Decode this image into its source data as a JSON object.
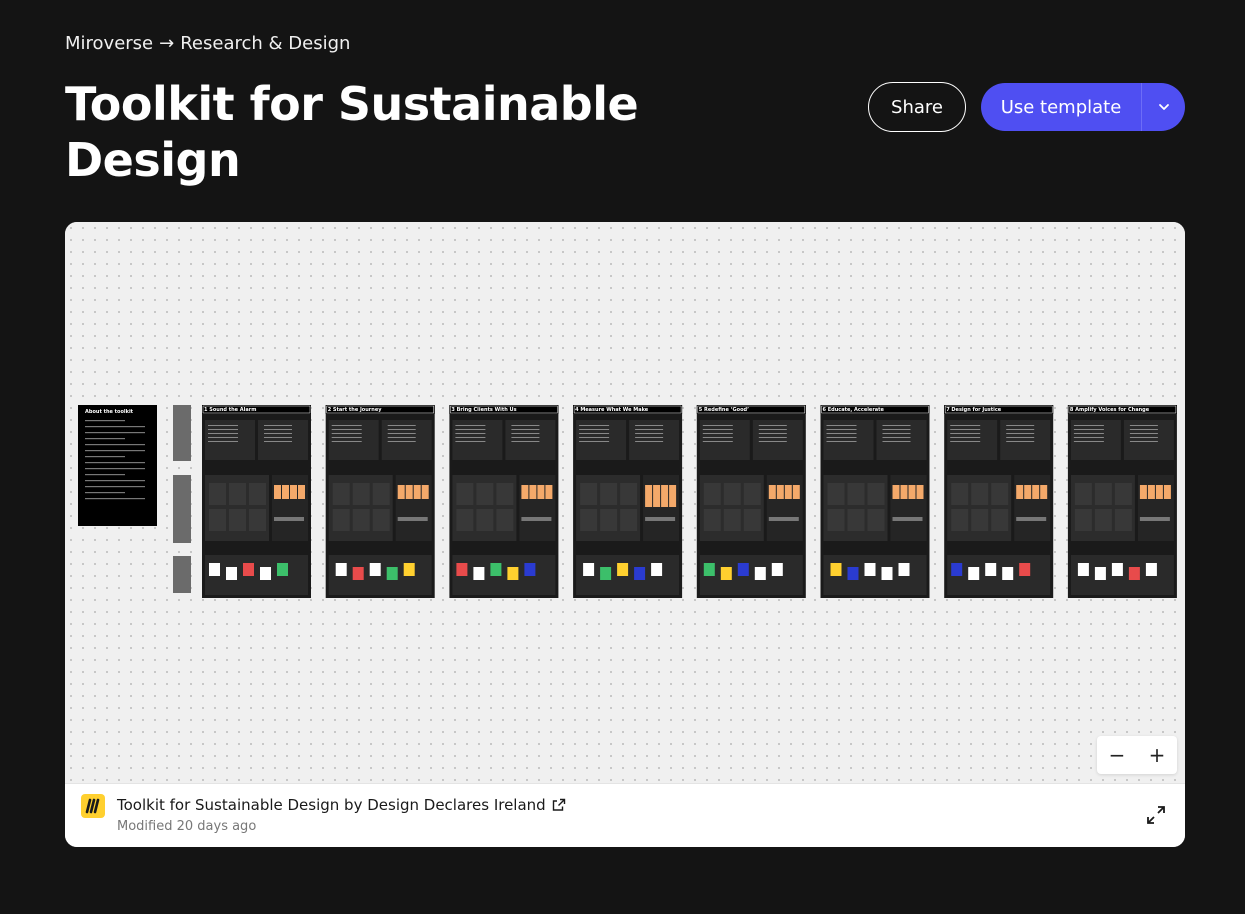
{
  "breadcrumb": {
    "parent": "Miroverse",
    "arrow": "→",
    "current": "Research & Design"
  },
  "page": {
    "title": "Toolkit for Sustainable Design"
  },
  "actions": {
    "share_label": "Share",
    "use_template_label": "Use template"
  },
  "board": {
    "intro_panel": "About the toolkit",
    "frames": [
      {
        "num": "1",
        "title": "Sound the Alarm"
      },
      {
        "num": "2",
        "title": "Start the Journey"
      },
      {
        "num": "3",
        "title": "Bring Clients With Us"
      },
      {
        "num": "4",
        "title": "Measure What We Make"
      },
      {
        "num": "5",
        "title": "Redefine ‘Good’"
      },
      {
        "num": "6",
        "title": "Educate, Accelerate"
      },
      {
        "num": "7",
        "title": "Design for Justice"
      },
      {
        "num": "8",
        "title": "Amplify Voices for Change"
      }
    ],
    "accent_color": "#f4a96a"
  },
  "zoom": {
    "minus": "−",
    "plus": "+"
  },
  "footer": {
    "board_title": "Toolkit for Sustainable Design by Design Declares Ireland",
    "modified": "Modified 20 days ago"
  },
  "colors": {
    "background": "#141414",
    "primary": "#4f4ff2",
    "logo": "#ffd02f"
  },
  "icons": [
    "chevron-down-icon",
    "external-link-icon",
    "expand-icon",
    "miro-logo-icon"
  ]
}
